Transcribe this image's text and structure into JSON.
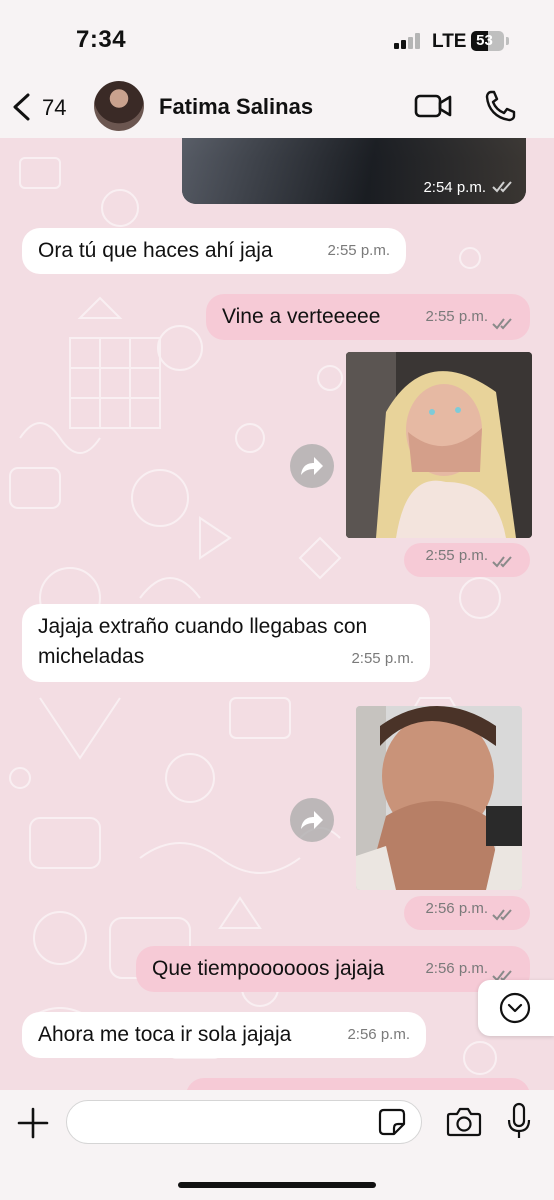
{
  "status_bar": {
    "time": "7:34",
    "network": "LTE",
    "battery_level": "53",
    "battery_fraction": 0.53
  },
  "header": {
    "back_count": "74",
    "contact_name": "Fatima Salinas",
    "icons": [
      "back-chevron-icon",
      "video-call-icon",
      "phone-call-icon"
    ]
  },
  "messages": [
    {
      "type": "media",
      "direction": "out",
      "time": "2:54 p.m.",
      "status": "read"
    },
    {
      "type": "text",
      "direction": "in",
      "text": "Ora tú que haces ahí jaja",
      "time": "2:55 p.m."
    },
    {
      "type": "text",
      "direction": "out",
      "text": "Vine a verteeeee",
      "time": "2:55 p.m.",
      "status": "read"
    },
    {
      "type": "media",
      "direction": "out",
      "time": "2:55 p.m.",
      "status": "read"
    },
    {
      "type": "text",
      "direction": "in",
      "text_line1": "Jajaja extraño cuando llegabas con",
      "text_line2": "micheladas",
      "time": "2:55 p.m."
    },
    {
      "type": "media",
      "direction": "out",
      "time": "2:56 p.m.",
      "status": "read"
    },
    {
      "type": "text",
      "direction": "out",
      "text": "Que tiempoooooos jajaja",
      "time": "2:56 p.m.",
      "status": "read"
    },
    {
      "type": "text",
      "direction": "in",
      "text": "Ahora me toca ir sola jajaja",
      "time": "2:56 p.m."
    }
  ],
  "colors": {
    "wallpaper": "#f3dde3",
    "outgoing_bubble": "#f6cad6",
    "incoming_bubble": "#ffffff",
    "read_ticks": "#8a8a8a"
  },
  "input": {
    "placeholder": "",
    "icons": [
      "plus-icon",
      "sticker-icon",
      "camera-icon",
      "microphone-icon"
    ]
  }
}
